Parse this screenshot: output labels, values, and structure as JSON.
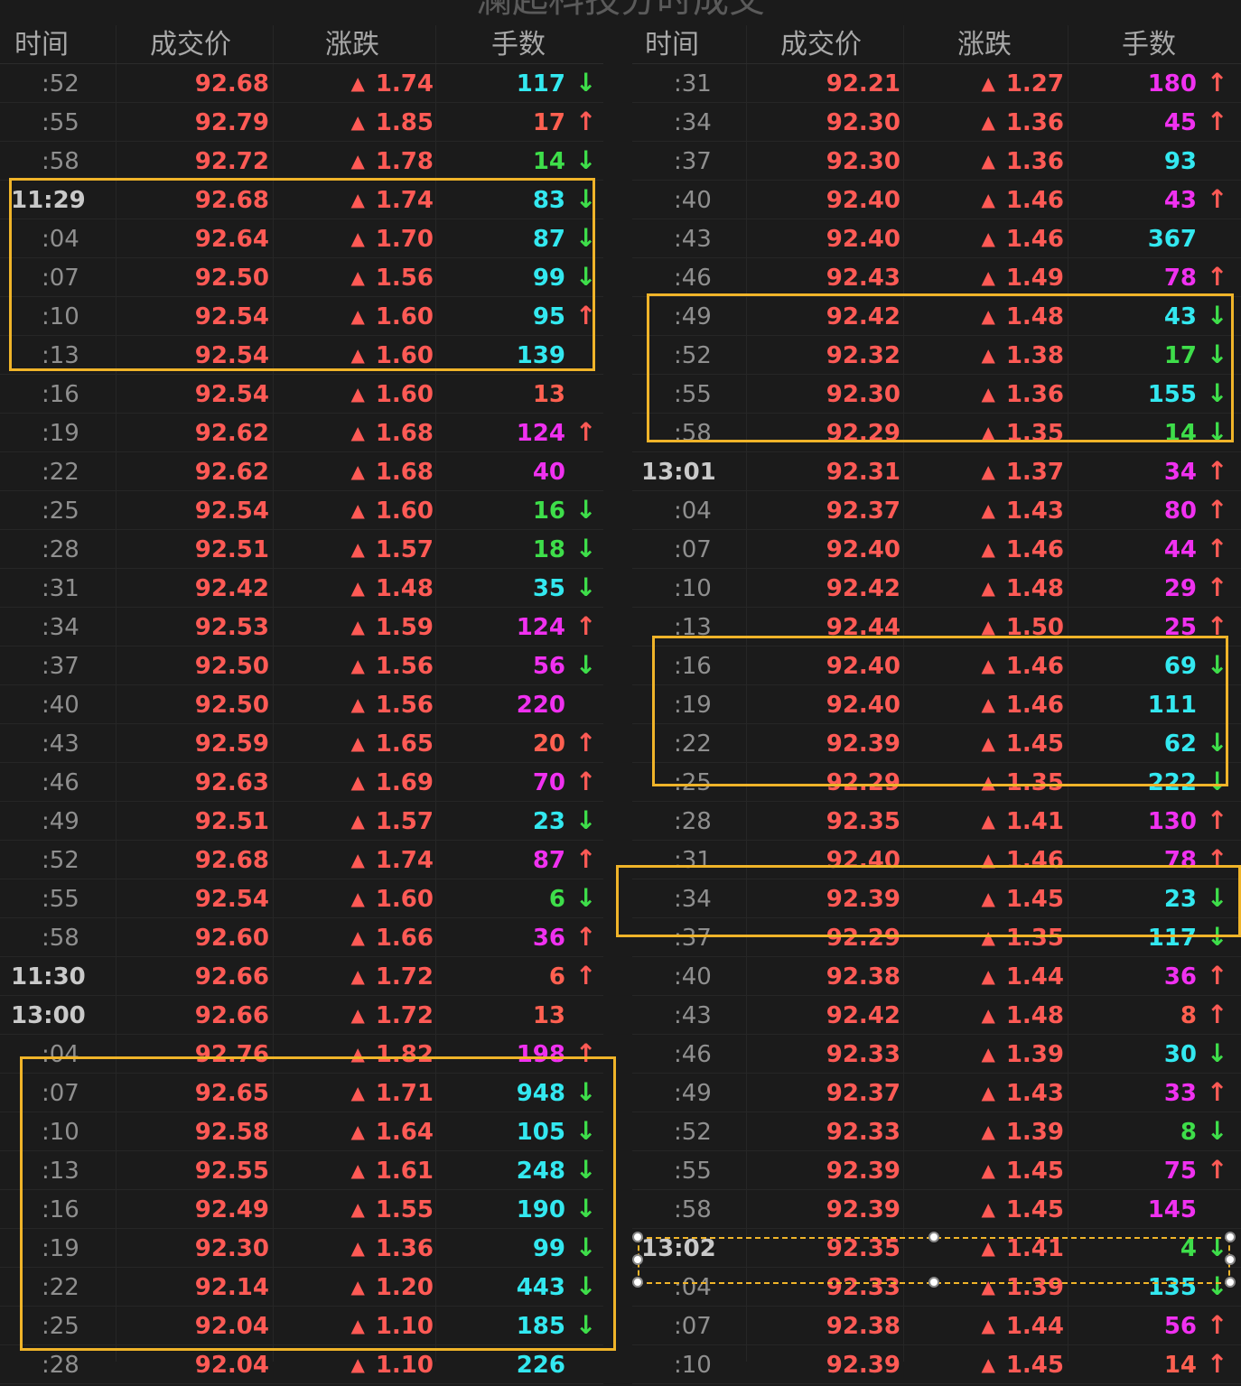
{
  "title": "澜起科技分时成交",
  "columns": [
    "时间",
    "成交价",
    "涨跌",
    "手数"
  ],
  "up_triangle": "▲",
  "arrows": {
    "up": "↑",
    "down": "↓"
  },
  "colors": {
    "background": "#1b1b1b",
    "price_up": "#ff5a55",
    "vol_cyan": "#33e8f0",
    "vol_magenta": "#f031f0",
    "vol_green": "#3ede4a",
    "vol_red": "#ff6050",
    "highlight_box": "#f0b429"
  },
  "left_rows": [
    {
      "time": ":52",
      "price": "92.68",
      "change": "1.74",
      "volume": "117",
      "vol_color": "cyan",
      "dir": "down"
    },
    {
      "time": ":55",
      "price": "92.79",
      "change": "1.85",
      "volume": "17",
      "vol_color": "red",
      "dir": "up"
    },
    {
      "time": ":58",
      "price": "92.72",
      "change": "1.78",
      "volume": "14",
      "vol_color": "green",
      "dir": "down"
    },
    {
      "time": "11:29",
      "price": "92.68",
      "change": "1.74",
      "volume": "83",
      "vol_color": "cyan",
      "dir": "down"
    },
    {
      "time": ":04",
      "price": "92.64",
      "change": "1.70",
      "volume": "87",
      "vol_color": "cyan",
      "dir": "down"
    },
    {
      "time": ":07",
      "price": "92.50",
      "change": "1.56",
      "volume": "99",
      "vol_color": "cyan",
      "dir": "down"
    },
    {
      "time": ":10",
      "price": "92.54",
      "change": "1.60",
      "volume": "95",
      "vol_color": "cyan",
      "dir": "up"
    },
    {
      "time": ":13",
      "price": "92.54",
      "change": "1.60",
      "volume": "139",
      "vol_color": "cyan",
      "dir": ""
    },
    {
      "time": ":16",
      "price": "92.54",
      "change": "1.60",
      "volume": "13",
      "vol_color": "red",
      "dir": ""
    },
    {
      "time": ":19",
      "price": "92.62",
      "change": "1.68",
      "volume": "124",
      "vol_color": "magenta",
      "dir": "up"
    },
    {
      "time": ":22",
      "price": "92.62",
      "change": "1.68",
      "volume": "40",
      "vol_color": "magenta",
      "dir": ""
    },
    {
      "time": ":25",
      "price": "92.54",
      "change": "1.60",
      "volume": "16",
      "vol_color": "green",
      "dir": "down"
    },
    {
      "time": ":28",
      "price": "92.51",
      "change": "1.57",
      "volume": "18",
      "vol_color": "green",
      "dir": "down"
    },
    {
      "time": ":31",
      "price": "92.42",
      "change": "1.48",
      "volume": "35",
      "vol_color": "cyan",
      "dir": "down"
    },
    {
      "time": ":34",
      "price": "92.53",
      "change": "1.59",
      "volume": "124",
      "vol_color": "magenta",
      "dir": "up"
    },
    {
      "time": ":37",
      "price": "92.50",
      "change": "1.56",
      "volume": "56",
      "vol_color": "magenta",
      "dir": "down"
    },
    {
      "time": ":40",
      "price": "92.50",
      "change": "1.56",
      "volume": "220",
      "vol_color": "magenta",
      "dir": ""
    },
    {
      "time": ":43",
      "price": "92.59",
      "change": "1.65",
      "volume": "20",
      "vol_color": "red",
      "dir": "up"
    },
    {
      "time": ":46",
      "price": "92.63",
      "change": "1.69",
      "volume": "70",
      "vol_color": "magenta",
      "dir": "up"
    },
    {
      "time": ":49",
      "price": "92.51",
      "change": "1.57",
      "volume": "23",
      "vol_color": "cyan",
      "dir": "down"
    },
    {
      "time": ":52",
      "price": "92.68",
      "change": "1.74",
      "volume": "87",
      "vol_color": "magenta",
      "dir": "up"
    },
    {
      "time": ":55",
      "price": "92.54",
      "change": "1.60",
      "volume": "6",
      "vol_color": "green",
      "dir": "down"
    },
    {
      "time": ":58",
      "price": "92.60",
      "change": "1.66",
      "volume": "36",
      "vol_color": "magenta",
      "dir": "up"
    },
    {
      "time": "11:30",
      "price": "92.66",
      "change": "1.72",
      "volume": "6",
      "vol_color": "red",
      "dir": "up"
    },
    {
      "time": "13:00",
      "price": "92.66",
      "change": "1.72",
      "volume": "13",
      "vol_color": "red",
      "dir": ""
    },
    {
      "time": ":04",
      "price": "92.76",
      "change": "1.82",
      "volume": "198",
      "vol_color": "magenta",
      "dir": "up"
    },
    {
      "time": ":07",
      "price": "92.65",
      "change": "1.71",
      "volume": "948",
      "vol_color": "cyan",
      "dir": "down"
    },
    {
      "time": ":10",
      "price": "92.58",
      "change": "1.64",
      "volume": "105",
      "vol_color": "cyan",
      "dir": "down"
    },
    {
      "time": ":13",
      "price": "92.55",
      "change": "1.61",
      "volume": "248",
      "vol_color": "cyan",
      "dir": "down"
    },
    {
      "time": ":16",
      "price": "92.49",
      "change": "1.55",
      "volume": "190",
      "vol_color": "cyan",
      "dir": "down"
    },
    {
      "time": ":19",
      "price": "92.30",
      "change": "1.36",
      "volume": "99",
      "vol_color": "cyan",
      "dir": "down"
    },
    {
      "time": ":22",
      "price": "92.14",
      "change": "1.20",
      "volume": "443",
      "vol_color": "cyan",
      "dir": "down"
    },
    {
      "time": ":25",
      "price": "92.04",
      "change": "1.10",
      "volume": "185",
      "vol_color": "cyan",
      "dir": "down"
    },
    {
      "time": ":28",
      "price": "92.04",
      "change": "1.10",
      "volume": "226",
      "vol_color": "cyan",
      "dir": ""
    }
  ],
  "right_rows": [
    {
      "time": ":31",
      "price": "92.21",
      "change": "1.27",
      "volume": "180",
      "vol_color": "magenta",
      "dir": "up"
    },
    {
      "time": ":34",
      "price": "92.30",
      "change": "1.36",
      "volume": "45",
      "vol_color": "magenta",
      "dir": "up"
    },
    {
      "time": ":37",
      "price": "92.30",
      "change": "1.36",
      "volume": "93",
      "vol_color": "cyan",
      "dir": ""
    },
    {
      "time": ":40",
      "price": "92.40",
      "change": "1.46",
      "volume": "43",
      "vol_color": "magenta",
      "dir": "up"
    },
    {
      "time": ":43",
      "price": "92.40",
      "change": "1.46",
      "volume": "367",
      "vol_color": "cyan",
      "dir": ""
    },
    {
      "time": ":46",
      "price": "92.43",
      "change": "1.49",
      "volume": "78",
      "vol_color": "magenta",
      "dir": "up"
    },
    {
      "time": ":49",
      "price": "92.42",
      "change": "1.48",
      "volume": "43",
      "vol_color": "cyan",
      "dir": "down"
    },
    {
      "time": ":52",
      "price": "92.32",
      "change": "1.38",
      "volume": "17",
      "vol_color": "green",
      "dir": "down"
    },
    {
      "time": ":55",
      "price": "92.30",
      "change": "1.36",
      "volume": "155",
      "vol_color": "cyan",
      "dir": "down"
    },
    {
      "time": ":58",
      "price": "92.29",
      "change": "1.35",
      "volume": "14",
      "vol_color": "green",
      "dir": "down"
    },
    {
      "time": "13:01",
      "price": "92.31",
      "change": "1.37",
      "volume": "34",
      "vol_color": "magenta",
      "dir": "up"
    },
    {
      "time": ":04",
      "price": "92.37",
      "change": "1.43",
      "volume": "80",
      "vol_color": "magenta",
      "dir": "up"
    },
    {
      "time": ":07",
      "price": "92.40",
      "change": "1.46",
      "volume": "44",
      "vol_color": "magenta",
      "dir": "up"
    },
    {
      "time": ":10",
      "price": "92.42",
      "change": "1.48",
      "volume": "29",
      "vol_color": "magenta",
      "dir": "up"
    },
    {
      "time": ":13",
      "price": "92.44",
      "change": "1.50",
      "volume": "25",
      "vol_color": "magenta",
      "dir": "up"
    },
    {
      "time": ":16",
      "price": "92.40",
      "change": "1.46",
      "volume": "69",
      "vol_color": "cyan",
      "dir": "down"
    },
    {
      "time": ":19",
      "price": "92.40",
      "change": "1.46",
      "volume": "111",
      "vol_color": "cyan",
      "dir": ""
    },
    {
      "time": ":22",
      "price": "92.39",
      "change": "1.45",
      "volume": "62",
      "vol_color": "cyan",
      "dir": "down"
    },
    {
      "time": ":25",
      "price": "92.29",
      "change": "1.35",
      "volume": "222",
      "vol_color": "cyan",
      "dir": "down"
    },
    {
      "time": ":28",
      "price": "92.35",
      "change": "1.41",
      "volume": "130",
      "vol_color": "magenta",
      "dir": "up"
    },
    {
      "time": ":31",
      "price": "92.40",
      "change": "1.46",
      "volume": "78",
      "vol_color": "magenta",
      "dir": "up"
    },
    {
      "time": ":34",
      "price": "92.39",
      "change": "1.45",
      "volume": "23",
      "vol_color": "cyan",
      "dir": "down"
    },
    {
      "time": ":37",
      "price": "92.29",
      "change": "1.35",
      "volume": "117",
      "vol_color": "cyan",
      "dir": "down"
    },
    {
      "time": ":40",
      "price": "92.38",
      "change": "1.44",
      "volume": "36",
      "vol_color": "magenta",
      "dir": "up"
    },
    {
      "time": ":43",
      "price": "92.42",
      "change": "1.48",
      "volume": "8",
      "vol_color": "red",
      "dir": "up"
    },
    {
      "time": ":46",
      "price": "92.33",
      "change": "1.39",
      "volume": "30",
      "vol_color": "cyan",
      "dir": "down"
    },
    {
      "time": ":49",
      "price": "92.37",
      "change": "1.43",
      "volume": "33",
      "vol_color": "magenta",
      "dir": "up"
    },
    {
      "time": ":52",
      "price": "92.33",
      "change": "1.39",
      "volume": "8",
      "vol_color": "green",
      "dir": "down"
    },
    {
      "time": ":55",
      "price": "92.39",
      "change": "1.45",
      "volume": "75",
      "vol_color": "magenta",
      "dir": "up"
    },
    {
      "time": ":58",
      "price": "92.39",
      "change": "1.45",
      "volume": "145",
      "vol_color": "magenta",
      "dir": ""
    },
    {
      "time": "13:02",
      "price": "92.35",
      "change": "1.41",
      "volume": "4",
      "vol_color": "green",
      "dir": "down"
    },
    {
      "time": ":04",
      "price": "92.33",
      "change": "1.39",
      "volume": "135",
      "vol_color": "cyan",
      "dir": "down"
    },
    {
      "time": ":07",
      "price": "92.38",
      "change": "1.44",
      "volume": "56",
      "vol_color": "magenta",
      "dir": "up"
    },
    {
      "time": ":10",
      "price": "92.39",
      "change": "1.45",
      "volume": "14",
      "vol_color": "red",
      "dir": "up"
    }
  ]
}
